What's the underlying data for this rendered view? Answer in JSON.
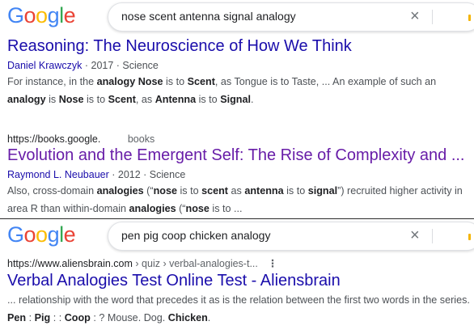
{
  "panel1": {
    "logo_letters": [
      {
        "ch": "G",
        "color": "#4285F4"
      },
      {
        "ch": "o",
        "color": "#EA4335"
      },
      {
        "ch": "o",
        "color": "#FBBC05"
      },
      {
        "ch": "g",
        "color": "#4285F4"
      },
      {
        "ch": "l",
        "color": "#34A853"
      },
      {
        "ch": "e",
        "color": "#EA4335"
      }
    ],
    "search_query": "nose scent antenna signal analogy",
    "clear_icon": "×",
    "result1": {
      "title": "Reasoning: The Neuroscience of How We Think",
      "author": "Daniel Krawczyk",
      "meta_rest": " · 2017 · Science",
      "snippet": [
        {
          "t": "For instance, in the "
        },
        {
          "t": "analogy Nose",
          "b": true
        },
        {
          "t": " is to "
        },
        {
          "t": "Scent",
          "b": true
        },
        {
          "t": ", as Tongue is to Taste, ... An example of such an "
        },
        {
          "t": "analogy",
          "b": true
        },
        {
          "t": " is "
        },
        {
          "t": "Nose",
          "b": true
        },
        {
          "t": " is to "
        },
        {
          "t": "Scent",
          "b": true
        },
        {
          "t": ", as "
        },
        {
          "t": "Antenna",
          "b": true
        },
        {
          "t": " is to "
        },
        {
          "t": "Signal",
          "b": true
        },
        {
          "t": "."
        }
      ]
    },
    "result2": {
      "url": "https://books.google.",
      "url_crumb": "books",
      "title": "Evolution and the Emergent Self: The Rise of Complexity and ...",
      "author": "Raymond L. Neubauer",
      "meta_rest": " · 2012 · Science",
      "snippet": [
        {
          "t": "Also, cross-domain "
        },
        {
          "t": "analogies",
          "b": true
        },
        {
          "t": " (“"
        },
        {
          "t": "nose",
          "b": true
        },
        {
          "t": " is to "
        },
        {
          "t": "scent",
          "b": true
        },
        {
          "t": " as "
        },
        {
          "t": "antenna",
          "b": true
        },
        {
          "t": " is to "
        },
        {
          "t": "signal",
          "b": true
        },
        {
          "t": "”) recruited higher activity in area R than within-domain "
        },
        {
          "t": "analogies",
          "b": true
        },
        {
          "t": " (“"
        },
        {
          "t": "nose",
          "b": true
        },
        {
          "t": " is to ..."
        }
      ]
    }
  },
  "panel2": {
    "search_query": "pen pig coop chicken analogy",
    "clear_icon": "×",
    "result1": {
      "url": "https://www.aliensbrain.com",
      "url_crumb": " › quiz › verbal-analogies-t...",
      "kebab": "⋮",
      "title": "Verbal Analogies Test Online Test - Aliensbrain",
      "snippet": [
        {
          "t": "... relationship with the word that precedes it as is the relation between the first two words in the series. "
        },
        {
          "t": "Pen",
          "b": true
        },
        {
          "t": " : "
        },
        {
          "t": "Pig",
          "b": true
        },
        {
          "t": " : : "
        },
        {
          "t": "Coop",
          "b": true
        },
        {
          "t": " : ? Mouse. Dog. "
        },
        {
          "t": "Chicken",
          "b": true
        },
        {
          "t": "."
        }
      ]
    }
  },
  "colors": {
    "link": "#1a0dab",
    "visited": "#681da8",
    "snippet_text": "#4d5156"
  }
}
